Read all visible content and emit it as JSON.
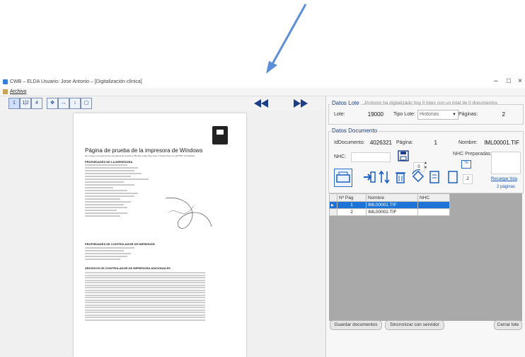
{
  "window": {
    "title": "CWB – ELDA Usuario: Jose Antonio – [Digitalización clínica]",
    "menu_file": "Archivo",
    "minimize": "–",
    "maximize": "□",
    "close": "×"
  },
  "toolbar": {
    "view_buttons": [
      "1",
      "1|2",
      "4"
    ]
  },
  "document": {
    "title": "Página de prueba de la impresora de Windows",
    "subtitle": "Ha impreso correctamente una página de prueba en Brother Laser Ray Type 1 Class Driver en LAPTOP-7C1AQ4KQ.",
    "sections": [
      "PROPIEDADES DE LA IMPRESORA",
      "PROPIEDADES DE CONTROLADOR DE IMPRESIÓN",
      "ARCHIVOS DE CONTROLADOR DE IMPRESORA ADICIONALES"
    ]
  },
  "lote": {
    "legend": "Datos Lote",
    "note": "JAntonio ha digitalizado hoy 0 lotes con un total de 0 documentos",
    "lote_label": "Lote:",
    "lote_value": "19000",
    "tipo_label": "Tipo Lote:",
    "tipo_value": "Historias",
    "paginas_label": "Páginas:",
    "paginas_value": "2"
  },
  "documento": {
    "legend": "Datos Documento",
    "id_label": "IdDocumento:",
    "id_value": "4026321",
    "pagina_label": "Página:",
    "pagina_value": "1",
    "nombre_label": "Nombre:",
    "nombre_value": "IML00001.TIF",
    "nhc_label": "NHC:",
    "nhc_preparadas_label": "NHC Preparadas:",
    "stepper_value": "0",
    "page_count_value": "2",
    "recargar_label": "Recargar lista",
    "paginas_link": "2 páginas"
  },
  "grid": {
    "headers": [
      "Nº Pág",
      "Nombre",
      "NHC"
    ],
    "rows": [
      {
        "pag": "1",
        "nombre": "IML00001.TIF",
        "nhc": ""
      },
      {
        "pag": "2",
        "nombre": "IML00002.TIF",
        "nhc": ""
      }
    ]
  },
  "footer": {
    "guardar": "Guardar documentos",
    "sincronizar": "Sincronizar con servidor",
    "cerrar": "Cerrar lote"
  }
}
